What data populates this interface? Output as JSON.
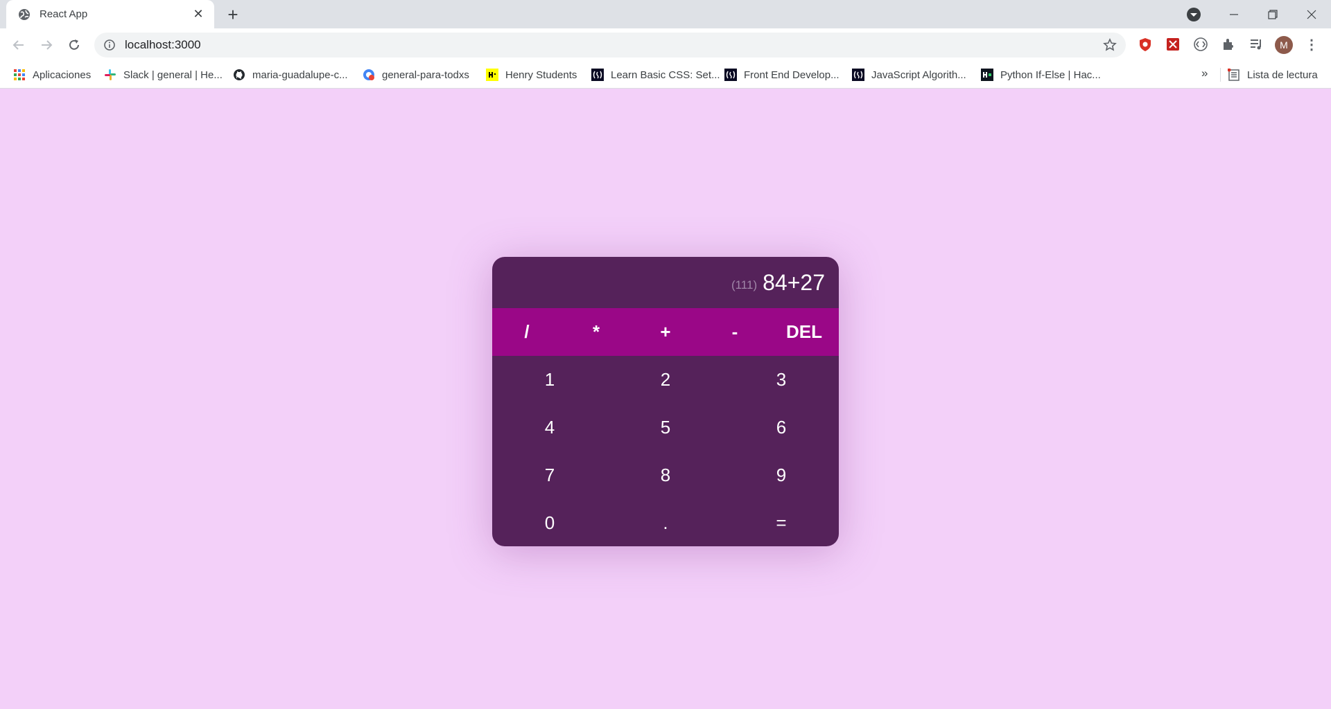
{
  "browser": {
    "tab_title": "React App",
    "url": "localhost:3000",
    "avatar_initial": "M",
    "bookmarks": [
      {
        "label": "Aplicaciones",
        "icon": "apps-grid-icon"
      },
      {
        "label": "Slack | general | He...",
        "icon": "slack-icon"
      },
      {
        "label": "maria-guadalupe-c...",
        "icon": "github-icon"
      },
      {
        "label": "general-para-todxs",
        "icon": "meet-icon"
      },
      {
        "label": "Henry Students",
        "icon": "henry-icon"
      },
      {
        "label": "Learn Basic CSS: Set...",
        "icon": "freecodecamp-icon"
      },
      {
        "label": "Front End Develop...",
        "icon": "freecodecamp-icon"
      },
      {
        "label": "JavaScript Algorith...",
        "icon": "freecodecamp-icon"
      },
      {
        "label": "Python If-Else | Hac...",
        "icon": "hackerrank-icon"
      }
    ],
    "more_bookmarks": "»",
    "reading_list": "Lista de lectura"
  },
  "calculator": {
    "result": "(111)",
    "expression": "84+27",
    "operators": [
      "/",
      "*",
      "+",
      "-",
      "DEL"
    ],
    "keys": [
      "1",
      "2",
      "3",
      "4",
      "5",
      "6",
      "7",
      "8",
      "9",
      "0",
      ".",
      "="
    ]
  },
  "colors": {
    "page_background": "#f3d0f9",
    "calculator_body": "#55225a",
    "operator_bar": "#9a0787"
  }
}
